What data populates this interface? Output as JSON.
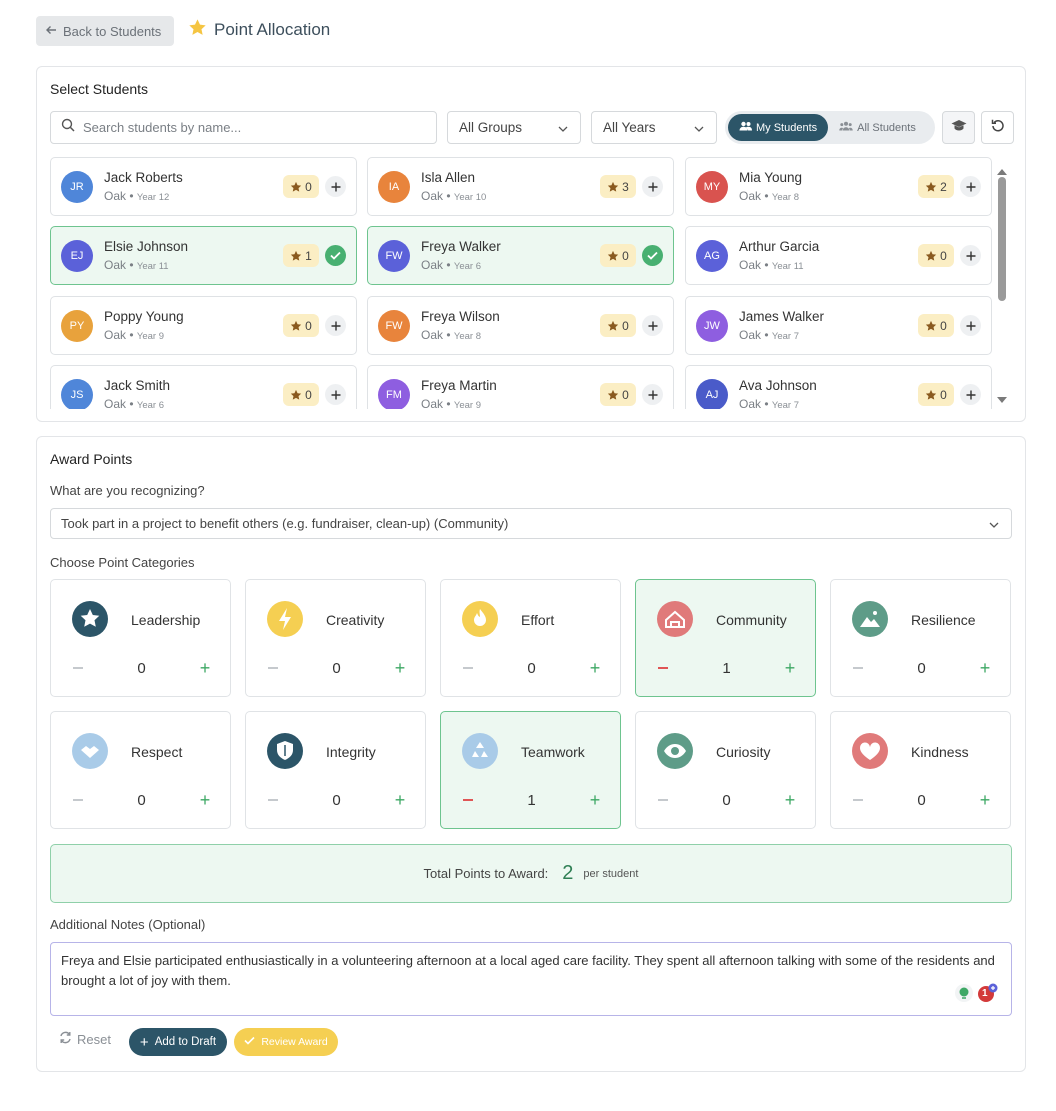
{
  "header": {
    "back_label": "Back to Students",
    "title": "Point Allocation"
  },
  "select_students": {
    "title": "Select Students",
    "search_placeholder": "Search students by name...",
    "group_filter": "All Groups",
    "year_filter": "All Years",
    "my_students_label": "My Students",
    "all_students_label": "All Students"
  },
  "students": [
    {
      "initials": "JR",
      "name": "Jack Roberts",
      "house": "Oak",
      "year": "Year 12",
      "points": "0",
      "selected": false,
      "color": "#4f86d9"
    },
    {
      "initials": "IA",
      "name": "Isla Allen",
      "house": "Oak",
      "year": "Year 10",
      "points": "3",
      "selected": false,
      "color": "#e8843c"
    },
    {
      "initials": "MY",
      "name": "Mia Young",
      "house": "Oak",
      "year": "Year 8",
      "points": "2",
      "selected": false,
      "color": "#d9534f"
    },
    {
      "initials": "EJ",
      "name": "Elsie Johnson",
      "house": "Oak",
      "year": "Year 11",
      "points": "1",
      "selected": true,
      "color": "#5b61d9"
    },
    {
      "initials": "FW",
      "name": "Freya Walker",
      "house": "Oak",
      "year": "Year 6",
      "points": "0",
      "selected": true,
      "color": "#5b61d9"
    },
    {
      "initials": "AG",
      "name": "Arthur Garcia",
      "house": "Oak",
      "year": "Year 11",
      "points": "0",
      "selected": false,
      "color": "#5b61d9"
    },
    {
      "initials": "PY",
      "name": "Poppy Young",
      "house": "Oak",
      "year": "Year 9",
      "points": "0",
      "selected": false,
      "color": "#e8a23c"
    },
    {
      "initials": "FW",
      "name": "Freya Wilson",
      "house": "Oak",
      "year": "Year 8",
      "points": "0",
      "selected": false,
      "color": "#e8843c"
    },
    {
      "initials": "JW",
      "name": "James Walker",
      "house": "Oak",
      "year": "Year 7",
      "points": "0",
      "selected": false,
      "color": "#8e5ee0"
    },
    {
      "initials": "JS",
      "name": "Jack Smith",
      "house": "Oak",
      "year": "Year 6",
      "points": "0",
      "selected": false,
      "color": "#4f86d9"
    },
    {
      "initials": "FM",
      "name": "Freya Martin",
      "house": "Oak",
      "year": "Year 9",
      "points": "0",
      "selected": false,
      "color": "#8e5ee0"
    },
    {
      "initials": "AJ",
      "name": "Ava Johnson",
      "house": "Oak",
      "year": "Year 7",
      "points": "0",
      "selected": false,
      "color": "#4a5bc9"
    }
  ],
  "award": {
    "title": "Award Points",
    "question_label": "What are you recognizing?",
    "reason_value": "Took part in a project to benefit others (e.g. fundraiser, clean-up) (Community)",
    "categories_label": "Choose Point Categories",
    "total_label": "Total Points to Award:",
    "total_value": "2",
    "total_suffix": "per student",
    "notes_label": "Additional Notes (Optional)",
    "notes_value": "Freya and Elsie participated enthusiastically in a volunteering afternoon at a local aged care facility. They spent all afternoon talking with some of the residents and brought a lot of joy with them.",
    "reset_label": "Reset",
    "draft_label": "Add to Draft",
    "review_label": "Review Award",
    "notes_badge_count": "1"
  },
  "categories": [
    {
      "name": "Leadership",
      "count": "0",
      "active": false,
      "icon": "star-icon",
      "color": "#2c5568"
    },
    {
      "name": "Creativity",
      "count": "0",
      "active": false,
      "icon": "lightning-icon",
      "color": "#f5cf52"
    },
    {
      "name": "Effort",
      "count": "0",
      "active": false,
      "icon": "flame-icon",
      "color": "#f5cf52"
    },
    {
      "name": "Community",
      "count": "1",
      "active": true,
      "icon": "community-icon",
      "color": "#e07a7a"
    },
    {
      "name": "Resilience",
      "count": "0",
      "active": false,
      "icon": "mountain-icon",
      "color": "#5e9c88"
    },
    {
      "name": "Respect",
      "count": "0",
      "active": false,
      "icon": "handshake-icon",
      "color": "#a9cbe8"
    },
    {
      "name": "Integrity",
      "count": "0",
      "active": false,
      "icon": "shield-icon",
      "color": "#2c5568"
    },
    {
      "name": "Teamwork",
      "count": "1",
      "active": true,
      "icon": "recycle-icon",
      "color": "#a9cbe8"
    },
    {
      "name": "Curiosity",
      "count": "0",
      "active": false,
      "icon": "eye-icon",
      "color": "#5e9c88"
    },
    {
      "name": "Kindness",
      "count": "0",
      "active": false,
      "icon": "heart-icon",
      "color": "#e07a7a"
    }
  ]
}
